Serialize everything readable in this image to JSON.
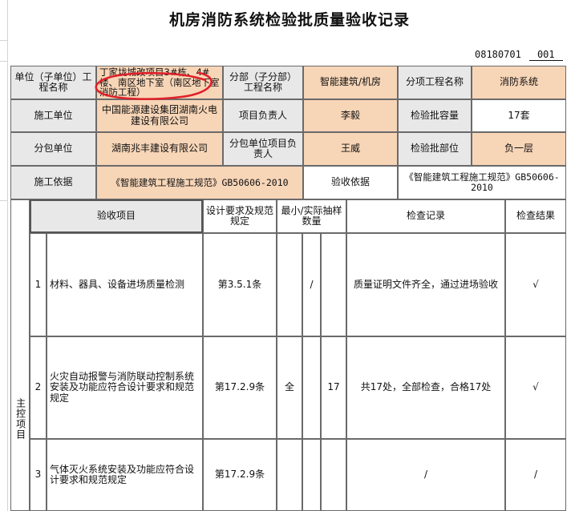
{
  "title": "机房消防系统检验批质量验收记录",
  "doc_code": "08180701",
  "doc_seq": "001",
  "info": {
    "unit_label": "单位（子单位）工程名称",
    "unit_value": "丁家垅城改项目3#栋、4#楼、南区地下室（南区地下室消防工程）",
    "branch_label": "分部（子分部）工程名称",
    "branch_value": "智能建筑/机房",
    "subitem_label": "分项工程名称",
    "subitem_value": "消防系统",
    "contractor_label": "施工单位",
    "contractor_value": "中国能源建设集团湖南火电建设有限公司",
    "pm_label": "项目负责人",
    "pm_value": "李毅",
    "capacity_label": "检验批容量",
    "capacity_value": "17套",
    "sub_label": "分包单位",
    "sub_value": "湖南兆丰建设有限公司",
    "sub_pm_label": "分包单位项目负责人",
    "sub_pm_value": "王威",
    "part_label": "检验批部位",
    "part_value": "负一层",
    "basis_label": "施工依据",
    "basis_value": "《智能建筑工程施工规范》GB50606-2010",
    "accept_basis_label": "验收依据",
    "accept_basis_value": "《智能建筑工程施工规范》GB50606-2010"
  },
  "table_header": {
    "item": "验收项目",
    "design": "设计要求及规范规定",
    "sample": "最小/实际抽样数量",
    "record": "检查记录",
    "result": "检查结果"
  },
  "group_label": "主控项目",
  "rows": [
    {
      "no": "1",
      "item": "材料、器具、设备进场质量检测",
      "clause": "第3.5.1条",
      "min": "",
      "actual": "/",
      "record": "质量证明文件齐全，通过进场验收",
      "result": "√"
    },
    {
      "no": "2",
      "item": "火灾自动报警与消防联动控制系统安装及功能应符合设计要求和规范规定",
      "clause": "第17.2.9条",
      "min": "全",
      "actual": "17",
      "record": "共17处，全部检查，合格17处",
      "result": "√"
    },
    {
      "no": "3",
      "item": "气体灭火系统安装及功能应符合设计要求和规范规定",
      "clause": "第17.2.9条",
      "min": "",
      "actual": "",
      "record": "/",
      "result": "/"
    }
  ],
  "colors": {
    "label_bg": "#e8e8e8",
    "value_bg": "#f7d5b7",
    "annotation": "#e0202a"
  }
}
